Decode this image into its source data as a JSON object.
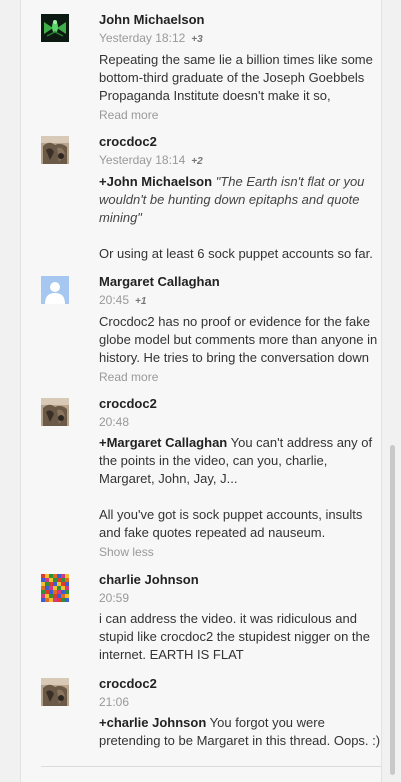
{
  "comments": [
    {
      "author": "John Michaelson",
      "time": "Yesterday 18:12",
      "plus": "+3",
      "lines": [
        "Repeating the same lie a billion times like some",
        "bottom-third graduate of the Joseph Goebbels",
        "Propaganda Institute doesn't make it so,"
      ],
      "more": "Read more",
      "avatar": "alien-avatar"
    },
    {
      "author": "crocdoc2",
      "time": "Yesterday 18:14",
      "plus": "+2",
      "mention": "+John Michaelson",
      "quote_l1": "\"The Earth isn't flat or you",
      "quote_l2": "wouldn't be hunting down epitaphs and quote",
      "quote_l3": "mining\"",
      "line2": "Or using at least 6 sock puppet accounts so far.",
      "avatar": "rock-avatar"
    },
    {
      "author": "Margaret Callaghan",
      "time": "20:45",
      "plus": "+1",
      "lines": [
        "Crocdoc2 has no proof or evidence for the fake",
        "globe model but comments more than anyone in",
        "history. He tries to bring the conversation down"
      ],
      "more": "Read more",
      "avatar": "default-person-avatar"
    },
    {
      "author": "crocdoc2",
      "time": "20:48",
      "mention": "+Margaret Callaghan",
      "l1": " You can't address any of",
      "l2": "the points in the video, can you, charlie,",
      "l3": "Margaret, John, Jay, J...",
      "p2l1": "All you've got is sock puppet accounts, insults",
      "p2l2": "and fake quotes repeated ad nauseum.",
      "more": "Show less",
      "avatar": "rock-avatar"
    },
    {
      "author": "charlie Johnson",
      "time": "20:59",
      "lines": [
        "i can address the video. it was ridiculous and",
        "stupid like crocdoc2 the stupidest nigger on the",
        "internet. EARTH IS FLAT"
      ],
      "avatar": "mosaic-avatar"
    },
    {
      "author": "crocdoc2",
      "time": "21:06",
      "mention": "+charlie Johnson",
      "l1": " You forgot you were",
      "l2": "pretending to be Margaret in this thread. Oops. :)",
      "avatar": "rock-avatar"
    }
  ]
}
